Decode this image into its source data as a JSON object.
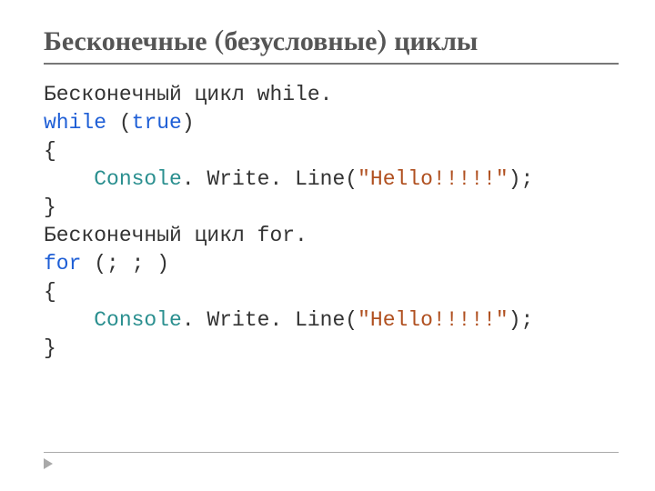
{
  "title": "Бесконечные (безусловные) циклы",
  "code": {
    "line1_desc": "Бесконечный цикл while.",
    "kw_while": "while",
    "sp": " ",
    "paren_open": "(",
    "kw_true": "true",
    "paren_close": ")",
    "brace_open": "{",
    "indent": "    ",
    "console": "Console",
    "dot1": ". ",
    "writeline": "Write. Line(",
    "str_hello": "\"Hello!!!!!\"",
    "line_end": ");",
    "brace_close": "}",
    "line2_desc": "Бесконечный цикл for.",
    "kw_for": "for",
    "for_args": " (; ; )"
  }
}
